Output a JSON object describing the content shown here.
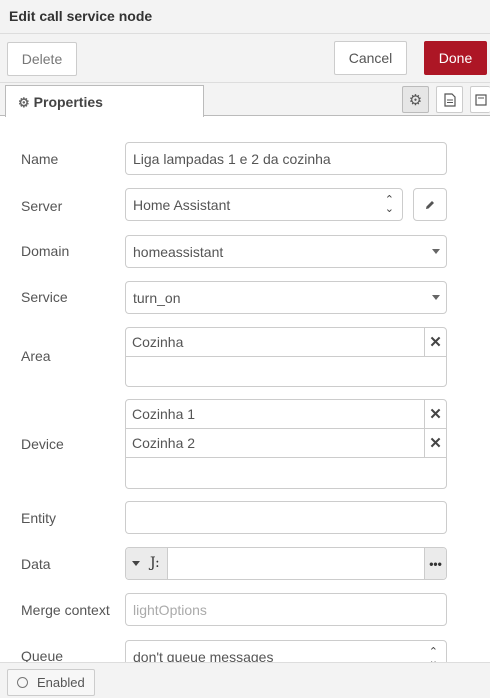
{
  "dialog": {
    "title": "Edit call service node"
  },
  "toolbar": {
    "delete_label": "Delete",
    "cancel_label": "Cancel",
    "done_label": "Done",
    "done_color": "#ad1625"
  },
  "tabs": {
    "properties_label": "Properties",
    "icons": [
      "gear-icon",
      "description-icon",
      "appearance-icon"
    ]
  },
  "form": {
    "name": {
      "label": "Name",
      "value": "Liga lampadas 1 e 2  da cozinha"
    },
    "server": {
      "label": "Server",
      "value": "Home Assistant"
    },
    "domain": {
      "label": "Domain",
      "value": "homeassistant"
    },
    "service": {
      "label": "Service",
      "value": "turn_on"
    },
    "area": {
      "label": "Area",
      "items": [
        "Cozinha"
      ]
    },
    "device": {
      "label": "Device",
      "items": [
        "Cozinha 1",
        "Cozinha 2"
      ]
    },
    "entity": {
      "label": "Entity",
      "value": ""
    },
    "data": {
      "label": "Data",
      "type_symbol": "J:",
      "value": ""
    },
    "merge_context": {
      "label": "Merge context",
      "placeholder": "lightOptions"
    },
    "queue": {
      "label": "Queue",
      "value": "don't queue messages"
    }
  },
  "footer": {
    "enabled_label": "Enabled"
  }
}
